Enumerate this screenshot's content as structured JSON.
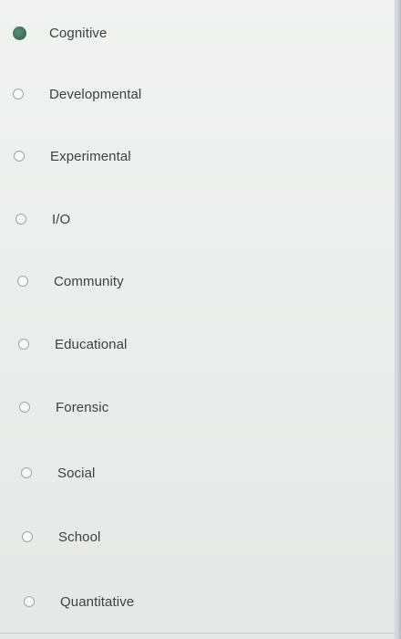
{
  "question": {
    "selected_index": 0,
    "options": [
      {
        "label": "Cognitive",
        "checked": true
      },
      {
        "label": "Developmental",
        "checked": false
      },
      {
        "label": "Experimental",
        "checked": false
      },
      {
        "label": "I/O",
        "checked": false
      },
      {
        "label": "Community",
        "checked": false
      },
      {
        "label": "Educational",
        "checked": false
      },
      {
        "label": "Forensic",
        "checked": false
      },
      {
        "label": "Social",
        "checked": false
      },
      {
        "label": "School",
        "checked": false
      },
      {
        "label": "Quantitative",
        "checked": false
      }
    ]
  },
  "colors": {
    "selected_radio": "#3d6e55",
    "radio_border": "#9ea5ab",
    "text": "#3d3f43",
    "background": "#eceeed"
  }
}
